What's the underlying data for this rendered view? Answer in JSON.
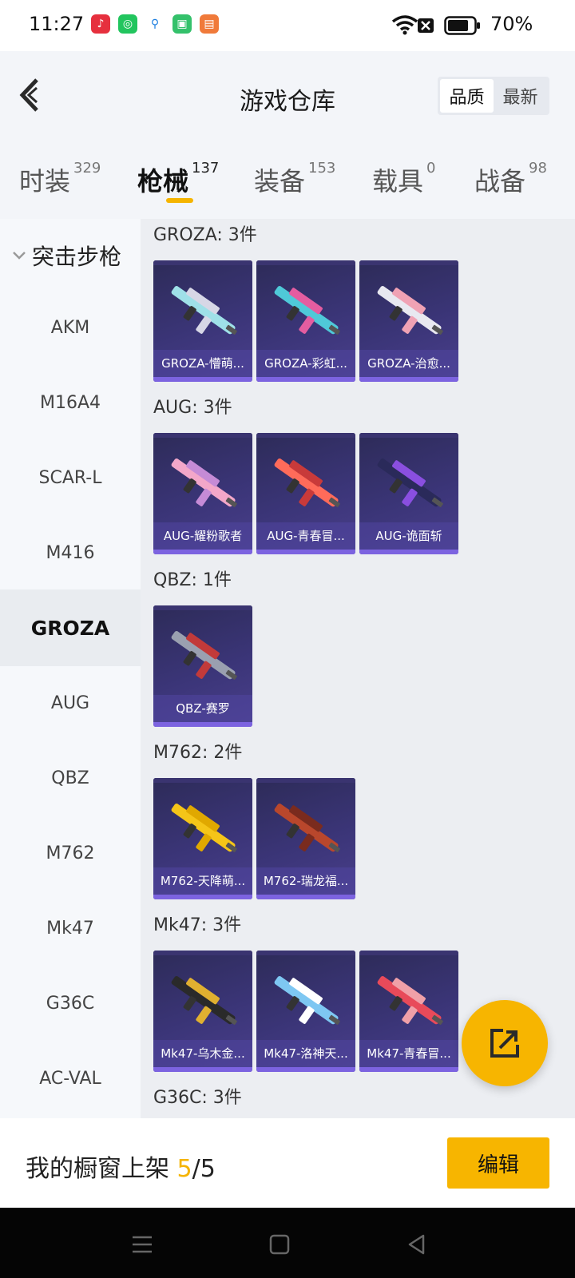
{
  "status_bar": {
    "time": "11:27",
    "battery_pct": "70%"
  },
  "header": {
    "title": "游戏仓库",
    "sort_options": [
      "品质",
      "最新"
    ],
    "active_sort": 0
  },
  "tabs": [
    {
      "label": "时装",
      "count": "329"
    },
    {
      "label": "枪械",
      "count": "137"
    },
    {
      "label": "装备",
      "count": "153"
    },
    {
      "label": "载具",
      "count": "0"
    },
    {
      "label": "战备",
      "count": "98"
    }
  ],
  "active_tab": 1,
  "sidebar": {
    "group": "突击步枪",
    "items": [
      "AKM",
      "M16A4",
      "SCAR-L",
      "M416",
      "GROZA",
      "AUG",
      "QBZ",
      "M762",
      "Mk47",
      "G36C",
      "AC-VAL"
    ],
    "active_index": 4
  },
  "sections": [
    {
      "title": "GROZA: 3件",
      "items": [
        {
          "label": "GROZA-懵萌...",
          "palette": [
            "#9fe0e8",
            "#d7d7e6"
          ]
        },
        {
          "label": "GROZA-彩虹...",
          "palette": [
            "#4fc9d8",
            "#e45da0"
          ]
        },
        {
          "label": "GROZA-治愈...",
          "palette": [
            "#e8e8f0",
            "#f0a2b4"
          ]
        }
      ]
    },
    {
      "title": "AUG: 3件",
      "items": [
        {
          "label": "AUG-耀粉歌者",
          "palette": [
            "#f3a7c9",
            "#c58bd6"
          ]
        },
        {
          "label": "AUG-青春冒...",
          "palette": [
            "#ff6b5a",
            "#c83a3a"
          ]
        },
        {
          "label": "AUG-诡面斩",
          "palette": [
            "#2a2a5a",
            "#8a4fe0"
          ]
        }
      ]
    },
    {
      "title": "QBZ: 1件",
      "items": [
        {
          "label": "QBZ-赛罗",
          "palette": [
            "#9aa0b0",
            "#c23a3a"
          ]
        }
      ]
    },
    {
      "title": "M762: 2件",
      "items": [
        {
          "label": "M762-天降萌...",
          "palette": [
            "#f5c518",
            "#e0a800"
          ]
        },
        {
          "label": "M762-瑞龙福...",
          "palette": [
            "#b9472c",
            "#7a2b1e"
          ]
        }
      ]
    },
    {
      "title": "Mk47: 3件",
      "items": [
        {
          "label": "Mk47-乌木金...",
          "palette": [
            "#2a2a2a",
            "#e0b030"
          ]
        },
        {
          "label": "Mk47-洛神天...",
          "palette": [
            "#7ec7f2",
            "#ffffff"
          ]
        },
        {
          "label": "Mk47-青春冒...",
          "palette": [
            "#e84a5a",
            "#f0a0a8"
          ]
        }
      ]
    },
    {
      "title": "G36C: 3件",
      "items": []
    }
  ],
  "showcase": {
    "label": "我的橱窗上架 ",
    "current": "5",
    "sep": "/",
    "max": "5"
  },
  "edit_button": "编辑",
  "icons": [
    "back-chevron-icon",
    "chevron-down-icon",
    "share-external-icon",
    "menu-icon",
    "home-square-icon",
    "back-triangle-icon",
    "wifi-icon",
    "battery-icon"
  ]
}
